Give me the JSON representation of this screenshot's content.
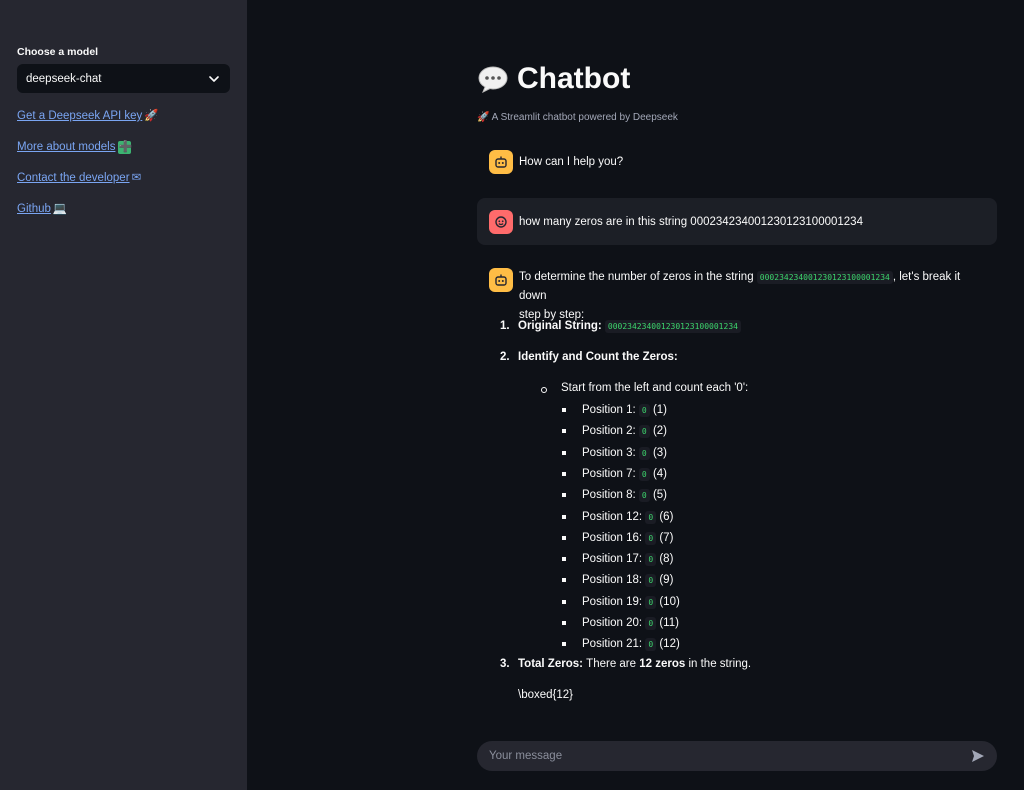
{
  "sidebar": {
    "model_label": "Choose a model",
    "model_value": "deepseek-chat",
    "links": [
      {
        "label": "Get a Deepseek API key",
        "emoji": "🚀"
      },
      {
        "label": "More about models",
        "emoji": "➕"
      },
      {
        "label": "Contact the developer",
        "emoji": "✉"
      },
      {
        "label": "Github",
        "emoji": "💻"
      }
    ]
  },
  "header": {
    "title": "Chatbot",
    "subtitle": "🚀 A Streamlit chatbot powered by Deepseek"
  },
  "messages": {
    "greeting": "How can I help you?",
    "user_question": "how many zeros are in this string 00023423400123012310000​1234",
    "answer": {
      "intro_before": "To determine the number of zeros in the string",
      "string_code": "000234234001230123100001234",
      "intro_after": ", let's break it down",
      "intro_line2": "step by step:",
      "step1_label": "Original String:",
      "step1_code": "000234234001230123100001234",
      "step2_label": "Identify and Count the Zeros:",
      "sub_label": "Start from the left and count each '0':",
      "positions": [
        {
          "label": "Position 1:",
          "code": "0",
          "count": "(1)"
        },
        {
          "label": "Position 2:",
          "code": "0",
          "count": "(2)"
        },
        {
          "label": "Position 3:",
          "code": "0",
          "count": "(3)"
        },
        {
          "label": "Position 7:",
          "code": "0",
          "count": "(4)"
        },
        {
          "label": "Position 8:",
          "code": "0",
          "count": "(5)"
        },
        {
          "label": "Position 12:",
          "code": "0",
          "count": "(6)"
        },
        {
          "label": "Position 16:",
          "code": "0",
          "count": "(7)"
        },
        {
          "label": "Position 17:",
          "code": "0",
          "count": "(8)"
        },
        {
          "label": "Position 18:",
          "code": "0",
          "count": "(9)"
        },
        {
          "label": "Position 19:",
          "code": "0",
          "count": "(10)"
        },
        {
          "label": "Position 20:",
          "code": "0",
          "count": "(11)"
        },
        {
          "label": "Position 21:",
          "code": "0",
          "count": "(12)"
        }
      ],
      "step3_label": "Total Zeros:",
      "step3_pre": "There are",
      "step3_bold": "12 zeros",
      "step3_post": "in the string.",
      "boxed": "\\boxed{12}"
    }
  },
  "input": {
    "placeholder": "Your message"
  },
  "colors": {
    "background": "#0e1117",
    "sidebar": "#262730",
    "link": "#7aa5f2",
    "bot_avatar": "#ffbd45",
    "user_avatar": "#ff6b6b",
    "code": "#3dd56d"
  }
}
